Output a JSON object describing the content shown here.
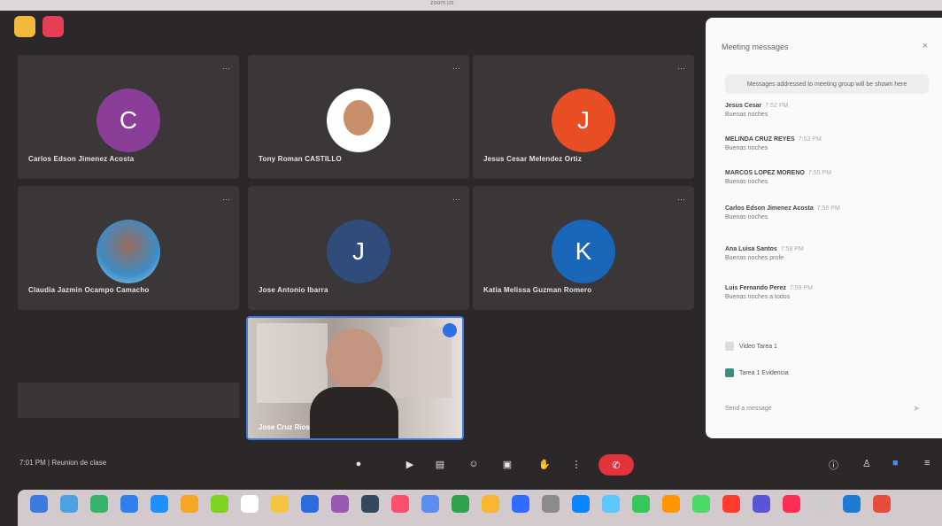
{
  "window": {
    "top_label": "zoom.us"
  },
  "participants": [
    {
      "name": "Carlos Edson Jimenez Acosta",
      "initial": "C",
      "avatar_color": "#8a3e98",
      "type": "initial"
    },
    {
      "name": "Tony Roman CASTILLO",
      "initial": "",
      "avatar_color": "#ffffff",
      "type": "photo"
    },
    {
      "name": "Jesus Cesar Melendez Ortiz",
      "initial": "J",
      "avatar_color": "#e84d24",
      "type": "initial"
    },
    {
      "name": "Claudia Jazmin Ocampo Camacho",
      "initial": "",
      "avatar_color": "#5aa0c8",
      "type": "photo"
    },
    {
      "name": "Jose Antonio Ibarra",
      "initial": "J",
      "avatar_color": "#2f4c7a",
      "type": "initial"
    },
    {
      "name": "Katia Melissa Guzman Romero",
      "initial": "K",
      "avatar_color": "#1a66b8",
      "type": "initial"
    }
  ],
  "self_view": {
    "name": "Jose Cruz Rios"
  },
  "chat": {
    "header": "Meeting messages",
    "notice": "Messages addressed to meeting group will be shown here",
    "messages": [
      {
        "sender": "Jesus Cesar",
        "time": "7:52 PM",
        "body": "Buenas noches"
      },
      {
        "sender": "MELINDA CRUZ REYES",
        "time": "7:53 PM",
        "body": "Buenas noches"
      },
      {
        "sender": "MARCOS LOPEZ MORENO",
        "time": "7:55 PM",
        "body": "Buenas noches"
      },
      {
        "sender": "Carlos Edson Jimenez Acosta",
        "time": "7:56 PM",
        "body": "Buenas noches"
      },
      {
        "sender": "Ana Luisa Santos",
        "time": "7:58 PM",
        "body": "Buenas noches profe"
      },
      {
        "sender": "Luis Fernando Perez",
        "time": "7:59 PM",
        "body": "Buenas noches a todos"
      }
    ],
    "attachments": [
      {
        "label": "Video Tarea 1",
        "color": "#dddddd"
      },
      {
        "label": "Tarea 1 Evidencia",
        "color": "#3b8f7a"
      }
    ],
    "input_placeholder": "Send a message"
  },
  "bottom": {
    "clock": "7:01 PM",
    "meeting_label": "Reunion de clase",
    "controls": [
      "mic-icon",
      "camera-icon",
      "participants-icon",
      "reactions-icon",
      "share-icon",
      "raise-hand-icon",
      "more-icon"
    ],
    "end_color": "#e0333c"
  },
  "dock": {
    "colors": [
      "#3a7be0",
      "#4aa3e0",
      "#36b36a",
      "#2f80ed",
      "#1e90ff",
      "#f5a623",
      "#7ed321",
      "#ffffff",
      "#f5c542",
      "#2d6cdf",
      "#9b59b6",
      "#34495e",
      "#ff4f6d",
      "#5b8def",
      "#2ea44f",
      "#f7b733",
      "#2f6bff",
      "#8b8b8b",
      "#0a84ff",
      "#5ac8fa",
      "#34c759",
      "#ff9500",
      "#4cd964",
      "#ff3b30",
      "#5856d6",
      "#ff2d55",
      "#cccccc",
      "#1c7cd5",
      "#e74c3c"
    ]
  }
}
